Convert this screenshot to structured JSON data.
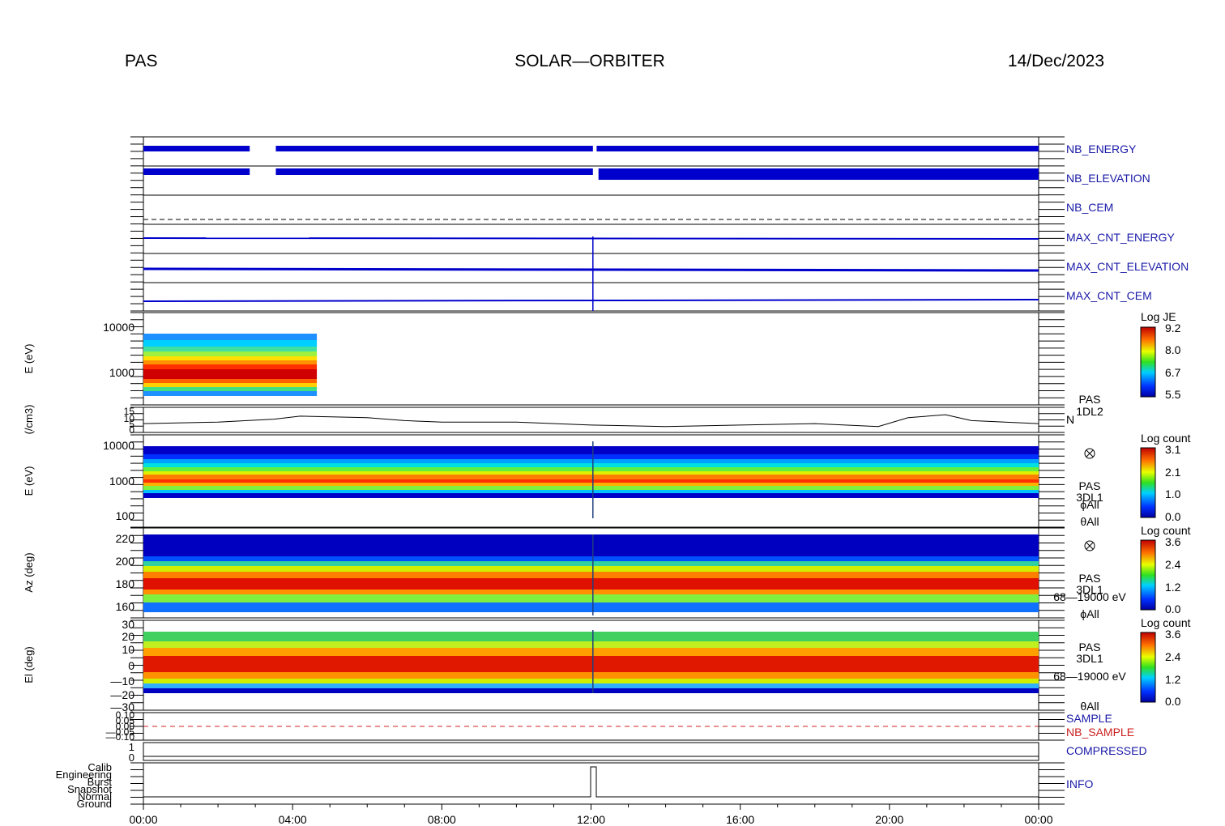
{
  "header": {
    "instrument": "PAS",
    "mission": "SOLAR—ORBITER",
    "date": "14/Dec/2023"
  },
  "colors": {
    "blue_label": "#1a1aa8",
    "red_label": "#cc2020",
    "trace": "#0000cc",
    "axis": "#000000"
  },
  "chart_data": {
    "type": "heatmap",
    "x_tick_labels": [
      "00:00",
      "04:00",
      "08:00",
      "12:00",
      "16:00",
      "20:00",
      "00:00"
    ],
    "x_hours": [
      0,
      4,
      8,
      12,
      16,
      20,
      24
    ],
    "hk_labels": [
      "NB_ENERGY",
      "NB_ELEVATION",
      "NB_CEM",
      "MAX_CNT_ENERGY",
      "MAX_CNT_ELEVATION",
      "MAX_CNT_CEM"
    ],
    "panels": {
      "je": {
        "ylabel": "E (eV)",
        "yticks": [
          "10000",
          "1000"
        ],
        "cbar_title": "Log JE",
        "cbar_ticks": [
          "9.2",
          "8.0",
          "6.7",
          "5.5"
        ],
        "coverage_hours": [
          0,
          4.65
        ],
        "peak_energy_ev": 900
      },
      "density": {
        "ylabel": "(/cm3)",
        "yticks": [
          "15",
          "10",
          "5",
          "0"
        ],
        "right_label": [
          "PAS",
          "1DL2"
        ],
        "series_label": "N",
        "x": [
          0,
          2,
          3.5,
          4.2,
          6,
          7,
          8,
          10,
          12,
          14,
          16,
          18,
          19.7,
          20.5,
          21.5,
          22.2,
          24
        ],
        "y": [
          6,
          7,
          9,
          11,
          10,
          8,
          7,
          7,
          5,
          4,
          5,
          6,
          4,
          10,
          12,
          8,
          6
        ]
      },
      "energy_spec": {
        "ylabel": "E (eV)",
        "yticks": [
          "10000",
          "1000",
          "100"
        ],
        "cbar_title": "Log count",
        "cbar_ticks": [
          "3.1",
          "2.1",
          "1.0",
          "0.0"
        ],
        "right_label": [
          "PAS",
          "3DL1",
          "ϕAll",
          "θAll"
        ]
      },
      "azimuth": {
        "ylabel": "Az (deg)",
        "yticks": [
          "220",
          "200",
          "180",
          "160"
        ],
        "cbar_title": "Log count",
        "cbar_ticks": [
          "3.6",
          "2.4",
          "1.2",
          "0.0"
        ],
        "right_label": [
          "PAS",
          "3DL1",
          "68—19000 eV",
          "ϕAll"
        ]
      },
      "elevation": {
        "ylabel": "El (deg)",
        "yticks": [
          "30",
          "20",
          "10",
          "0",
          "—10",
          "—20",
          "—30"
        ],
        "cbar_title": "Log count",
        "cbar_ticks": [
          "3.6",
          "2.4",
          "1.2",
          "0.0"
        ],
        "right_label": [
          "PAS",
          "3DL1",
          "68—19000 eV",
          "θAll"
        ]
      },
      "sample": {
        "yticks": [
          "0.10",
          "0.05",
          "0.00",
          "—0.05",
          "—0.10"
        ],
        "labels": [
          "SAMPLE",
          "NB_SAMPLE"
        ]
      },
      "compressed": {
        "yticks": [
          "1",
          "0"
        ],
        "label": "COMPRESSED"
      },
      "info": {
        "yticks": [
          "Calib",
          "Engineering",
          "Burst",
          "Snapshot",
          "Normal",
          "Ground"
        ],
        "label": "INFO"
      }
    }
  }
}
